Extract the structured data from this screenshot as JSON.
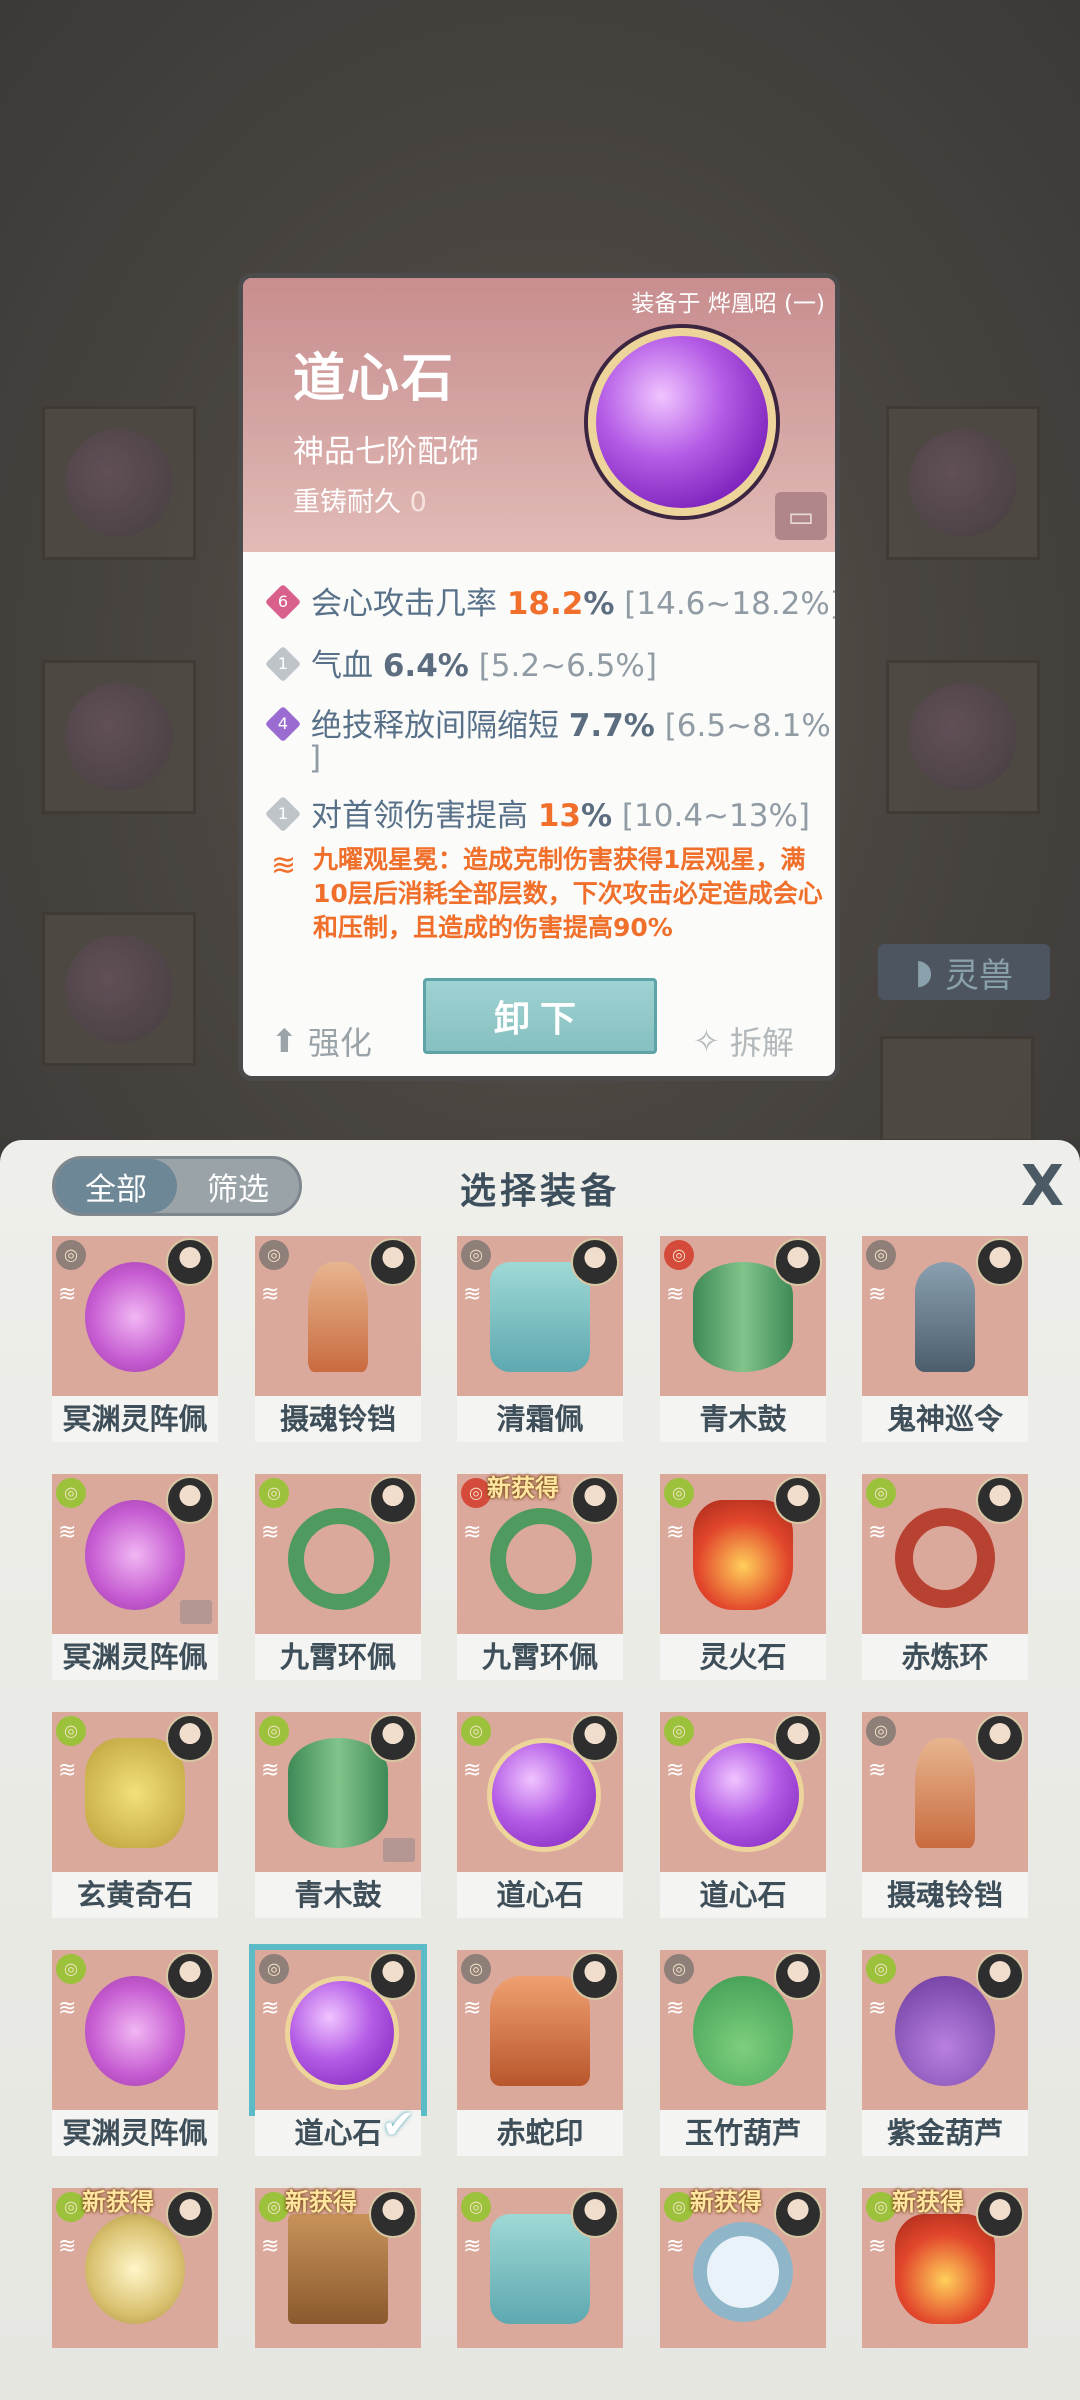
{
  "card": {
    "equipped_on": "装备于 烨凰昭 (一)",
    "name": "道心石",
    "grade": "神品七阶配饰",
    "durability_label": "重铸耐久",
    "durability_value": "0",
    "attributes": [
      {
        "badge": "6",
        "badge_color": "#d9608c",
        "label": "会心攻击几率",
        "value": "18.2",
        "unit": "%",
        "range": "[14.6~18.2%]",
        "highlight": true
      },
      {
        "badge": "1",
        "badge_color": "#bfc4c8",
        "label": "气血",
        "value": "6.4%",
        "unit": "",
        "range": "[5.2~6.5%]",
        "highlight": false
      },
      {
        "badge": "4",
        "badge_color": "#9a6bd1",
        "label": "绝技释放间隔缩短",
        "value": "7.7%",
        "unit": "",
        "range": "[6.5~8.1%",
        "range_cont": "]",
        "highlight": false
      },
      {
        "badge": "1",
        "badge_color": "#bfc4c8",
        "label": "对首领伤害提高",
        "value": "13",
        "unit": "%",
        "range": "[10.4~13%]",
        "highlight": true
      }
    ],
    "skill": "九曜观星冕：造成克制伤害获得1层观星，满10层后消耗全部层数，下次攻击必定造成会心和压制，且造成的伤害提高90%",
    "btn_strengthen": "强化",
    "btn_unequip": "卸下",
    "btn_dismantle": "拆解"
  },
  "background": {
    "tab_label": "灵兽"
  },
  "panel": {
    "seg_all": "全部",
    "seg_filter": "筛选",
    "title": "选择装备",
    "close": "X",
    "new_tag": "新获得",
    "items": [
      {
        "name": "冥渊灵阵佩",
        "shape": "s-pink",
        "elem": "",
        "new": false,
        "lock": false,
        "sel": false
      },
      {
        "name": "摄魂铃铛",
        "shape": "s-bell",
        "elem": "",
        "new": false,
        "lock": false,
        "sel": false
      },
      {
        "name": "清霜佩",
        "shape": "s-jade",
        "elem": "",
        "new": false,
        "lock": false,
        "sel": false
      },
      {
        "name": "青木鼓",
        "shape": "s-drum",
        "elem": "r",
        "new": false,
        "lock": false,
        "sel": false
      },
      {
        "name": "鬼神巡令",
        "shape": "s-mace",
        "elem": "",
        "new": false,
        "lock": false,
        "sel": false
      },
      {
        "name": "冥渊灵阵佩",
        "shape": "s-pink",
        "elem": "g",
        "new": false,
        "lock": true,
        "sel": false
      },
      {
        "name": "九霄环佩",
        "shape": "s-ring",
        "elem": "g",
        "new": false,
        "lock": false,
        "sel": false
      },
      {
        "name": "九霄环佩",
        "shape": "s-ring",
        "elem": "r",
        "new": true,
        "lock": false,
        "sel": false
      },
      {
        "name": "灵火石",
        "shape": "s-fire",
        "elem": "g",
        "new": false,
        "lock": false,
        "sel": false
      },
      {
        "name": "赤炼环",
        "shape": "s-redring",
        "elem": "g",
        "new": false,
        "lock": false,
        "sel": false
      },
      {
        "name": "玄黄奇石",
        "shape": "s-gold",
        "elem": "g",
        "new": false,
        "lock": false,
        "sel": false
      },
      {
        "name": "青木鼓",
        "shape": "s-drum",
        "elem": "g",
        "new": false,
        "lock": true,
        "sel": false
      },
      {
        "name": "道心石",
        "shape": "s-orb",
        "elem": "g",
        "new": false,
        "lock": false,
        "sel": false
      },
      {
        "name": "道心石",
        "shape": "s-orb",
        "elem": "g",
        "new": false,
        "lock": false,
        "sel": false
      },
      {
        "name": "摄魂铃铛",
        "shape": "s-bell",
        "elem": "",
        "new": false,
        "lock": false,
        "sel": false
      },
      {
        "name": "冥渊灵阵佩",
        "shape": "s-pink",
        "elem": "g",
        "new": false,
        "lock": false,
        "sel": false
      },
      {
        "name": "道心石",
        "shape": "s-orb",
        "elem": "",
        "new": false,
        "lock": false,
        "sel": true
      },
      {
        "name": "赤蛇印",
        "shape": "s-seal",
        "elem": "",
        "new": false,
        "lock": false,
        "sel": false
      },
      {
        "name": "玉竹葫芦",
        "shape": "s-gourd",
        "elem": "",
        "new": false,
        "lock": false,
        "sel": false
      },
      {
        "name": "紫金葫芦",
        "shape": "s-pgourd",
        "elem": "g",
        "new": false,
        "lock": false,
        "sel": false
      },
      {
        "name": "",
        "shape": "s-coil",
        "elem": "g",
        "new": true,
        "lock": false,
        "sel": false
      },
      {
        "name": "",
        "shape": "s-box",
        "elem": "g",
        "new": true,
        "lock": false,
        "sel": false
      },
      {
        "name": "",
        "shape": "s-jade",
        "elem": "g",
        "new": false,
        "lock": false,
        "sel": false
      },
      {
        "name": "",
        "shape": "s-mirror",
        "elem": "g",
        "new": true,
        "lock": false,
        "sel": false
      },
      {
        "name": "",
        "shape": "s-fire",
        "elem": "g",
        "new": true,
        "lock": false,
        "sel": false
      }
    ]
  }
}
